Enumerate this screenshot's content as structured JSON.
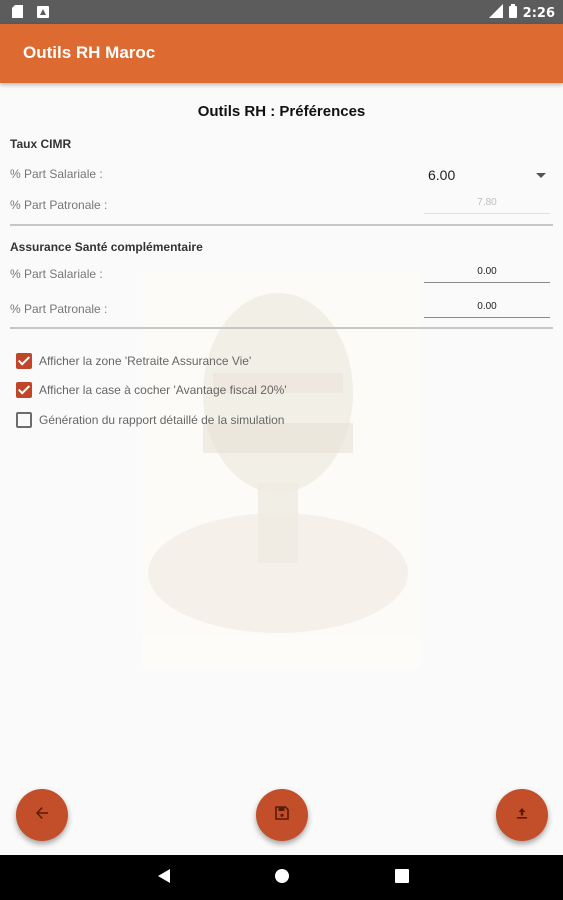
{
  "status_bar": {
    "time": "2:26",
    "left_icons": [
      "sd-card-icon",
      "notification-icon"
    ],
    "right_icons": [
      "signal-icon",
      "battery-icon"
    ]
  },
  "app_bar": {
    "title": "Outils RH Maroc"
  },
  "page_title": "Outils RH : Préférences",
  "cimr": {
    "section_title": "Taux CIMR",
    "salariale_label": "% Part Salariale :",
    "salariale_value": "6.00",
    "patronale_label": "% Part Patronale :",
    "patronale_value": "7.80"
  },
  "assurance": {
    "section_title": "Assurance Santé complémentaire",
    "salariale_label": "% Part Salariale :",
    "salariale_value": "0.00",
    "patronale_label": "% Part Patronale :",
    "patronale_value": "0.00"
  },
  "options": [
    {
      "label": "Afficher la zone 'Retraite Assurance Vie'",
      "checked": true
    },
    {
      "label": "Afficher la case à cocher 'Avantage fiscal 20%'",
      "checked": true
    },
    {
      "label": "Génération du rapport détaillé de la simulation",
      "checked": false
    }
  ],
  "fabs": {
    "back": "arrow-left-icon",
    "save": "save-icon",
    "share": "upload-icon"
  },
  "colors": {
    "app_bar": "#dd6a30",
    "accent": "#c24f29",
    "status_bar": "#5c5c5c",
    "nav_bar": "#000000"
  }
}
